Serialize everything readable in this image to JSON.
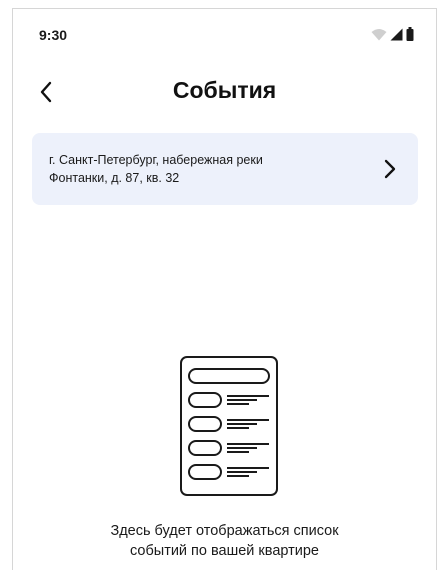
{
  "status_bar": {
    "time": "9:30",
    "icons": [
      "wifi-icon",
      "signal-icon",
      "battery-icon"
    ]
  },
  "header": {
    "title": "События",
    "back_icon": "chevron-left-icon"
  },
  "address_card": {
    "line1": "г. Санкт-Петербург, набережная реки",
    "line2": "Фонтанки, д. 87, кв. 32",
    "chevron_icon": "chevron-right-icon"
  },
  "empty_state": {
    "illustration_icon": "document-list-icon",
    "line1": "Здесь будет отображаться список",
    "line2": "событий по вашей квартире"
  },
  "colors": {
    "card_background": "#edf1fb",
    "text": "#111111",
    "frame_border": "#d6d6d6"
  }
}
